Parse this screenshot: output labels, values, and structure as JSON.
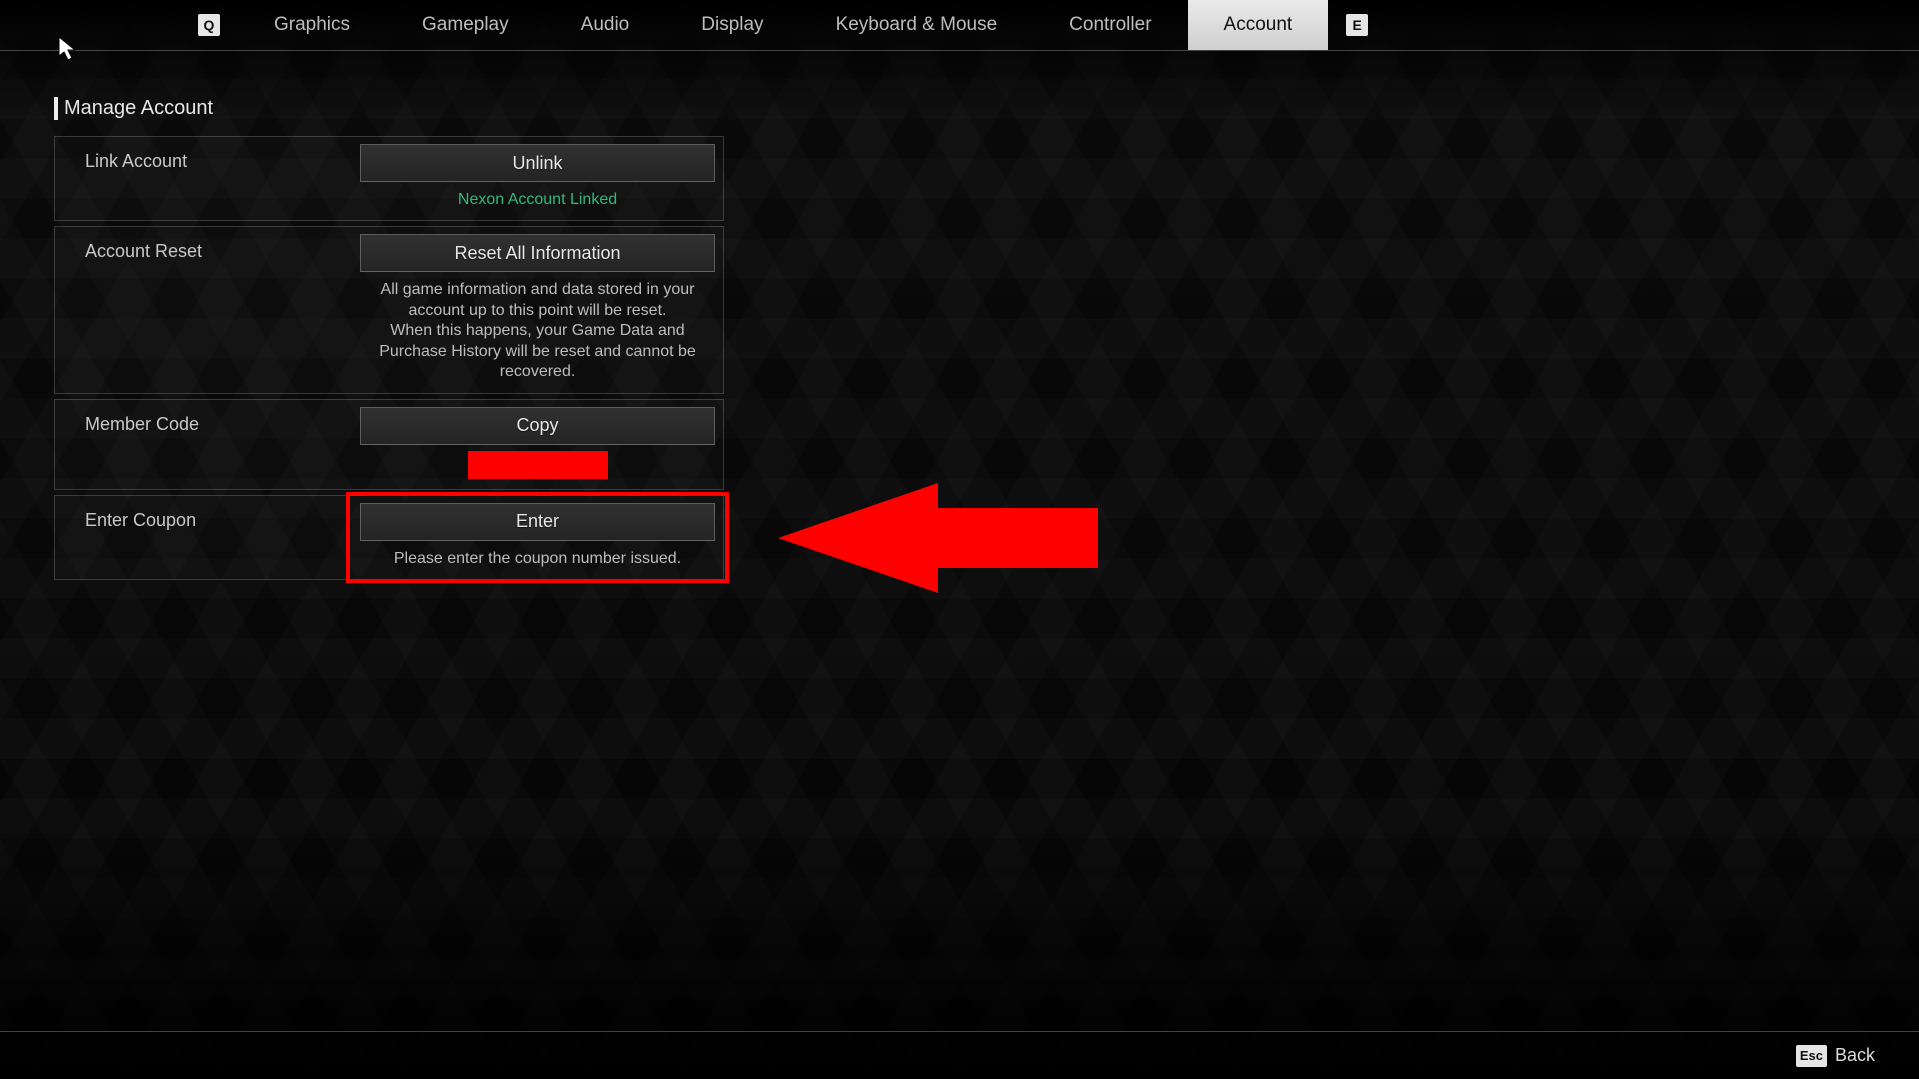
{
  "nav": {
    "key_left": "Q",
    "key_right": "E",
    "tabs": [
      "Graphics",
      "Gameplay",
      "Audio",
      "Display",
      "Keyboard & Mouse",
      "Controller",
      "Account"
    ],
    "active_tab": "Account"
  },
  "section": {
    "title": "Manage Account",
    "rows": {
      "link_account": {
        "label": "Link Account",
        "button": "Unlink",
        "status": "Nexon Account Linked"
      },
      "account_reset": {
        "label": "Account Reset",
        "button": "Reset All Information",
        "note_line1": "All game information and data stored in your account up to this point will be reset.",
        "note_line2": "When this happens, your Game Data and Purchase History will be reset and cannot be recovered."
      },
      "member_code": {
        "label": "Member Code",
        "button": "Copy"
      },
      "enter_coupon": {
        "label": "Enter Coupon",
        "button": "Enter",
        "hint": "Please enter the coupon number issued."
      }
    }
  },
  "footer": {
    "esc_key": "Esc",
    "back_label": "Back"
  },
  "annotations": {
    "highlight_target": "enter-coupon-panel-right",
    "arrow_points_to": "enter-coupon-panel-right",
    "redacted_field": "member-code-value"
  }
}
